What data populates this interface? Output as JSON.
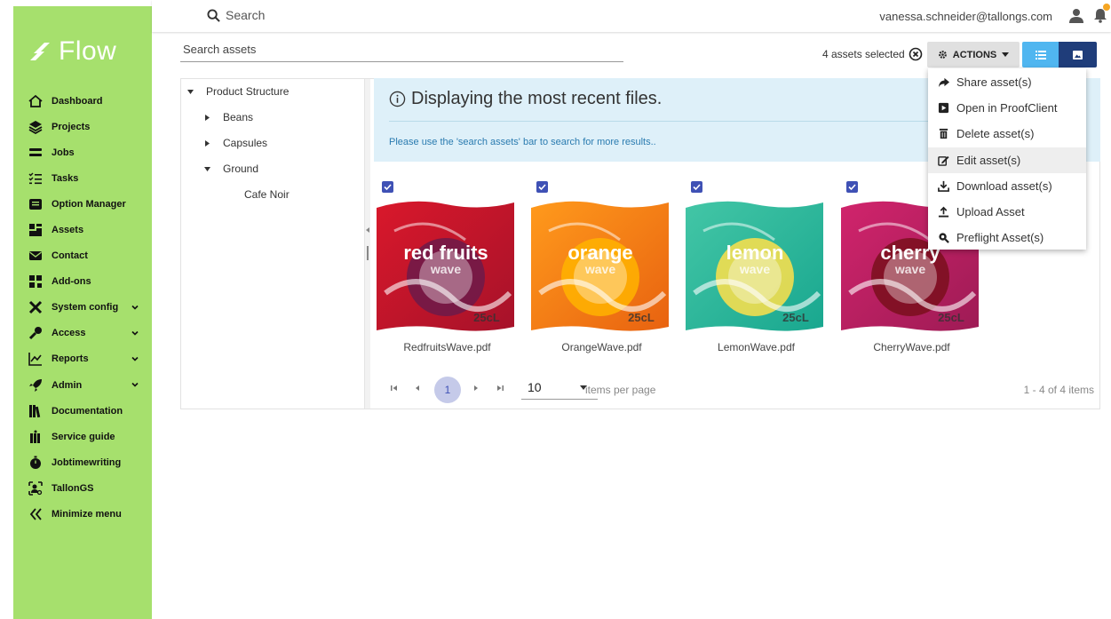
{
  "app": {
    "logo_text": "Flow"
  },
  "sidebar": {
    "items": [
      {
        "label": "Dashboard",
        "icon": "home-icon",
        "has_chevron": false
      },
      {
        "label": "Projects",
        "icon": "layers-icon",
        "has_chevron": false
      },
      {
        "label": "Jobs",
        "icon": "list-icon",
        "has_chevron": false
      },
      {
        "label": "Tasks",
        "icon": "tasks-icon",
        "has_chevron": false
      },
      {
        "label": "Option Manager",
        "icon": "option-icon",
        "has_chevron": false
      },
      {
        "label": "Assets",
        "icon": "assets-icon",
        "has_chevron": false
      },
      {
        "label": "Contact",
        "icon": "mail-icon",
        "has_chevron": false
      },
      {
        "label": "Add-ons",
        "icon": "addons-icon",
        "has_chevron": false
      },
      {
        "label": "System config",
        "icon": "tools-icon",
        "has_chevron": true
      },
      {
        "label": "Access",
        "icon": "key-icon",
        "has_chevron": true
      },
      {
        "label": "Reports",
        "icon": "chart-icon",
        "has_chevron": true
      },
      {
        "label": "Admin",
        "icon": "rocket-icon",
        "has_chevron": true
      },
      {
        "label": "Documentation",
        "icon": "books-icon",
        "has_chevron": false
      },
      {
        "label": "Service guide",
        "icon": "guide-icon",
        "has_chevron": false
      },
      {
        "label": "Jobtimewriting",
        "icon": "stopwatch-icon",
        "has_chevron": false
      },
      {
        "label": "TallonGS",
        "icon": "user-search-icon",
        "has_chevron": false
      },
      {
        "label": "Minimize menu",
        "icon": "double-chevron-left-icon",
        "has_chevron": false
      }
    ]
  },
  "topbar": {
    "search_label": "Search",
    "user_email": "vanessa.schneider@tallongs.com"
  },
  "toolbar": {
    "asset_search_placeholder": "Search assets",
    "selected_text": "4 assets selected",
    "actions_label": "ACTIONS"
  },
  "actions_menu": {
    "items": [
      {
        "label": "Share asset(s)",
        "icon": "share-icon"
      },
      {
        "label": "Open in ProofClient",
        "icon": "proofclient-icon"
      },
      {
        "label": "Delete asset(s)",
        "icon": "trash-icon"
      },
      {
        "label": "Edit asset(s)",
        "icon": "edit-icon"
      },
      {
        "label": "Download asset(s)",
        "icon": "download-icon"
      },
      {
        "label": "Upload Asset",
        "icon": "upload-icon"
      },
      {
        "label": "Preflight Asset(s)",
        "icon": "preflight-icon"
      }
    ],
    "hovered_index": 3
  },
  "tree": {
    "root": "Product Structure",
    "children": [
      "Beans",
      "Capsules",
      "Ground"
    ],
    "grandchild": "Cafe Noir"
  },
  "info": {
    "title": "Displaying the most recent files.",
    "text": "Please use the 'search assets' bar to search for more results.."
  },
  "assets": [
    {
      "name": "RedfruitsWave.pdf",
      "brand": "red fruits",
      "wave": "wave",
      "size": "25cL",
      "colors": [
        "#d9182b",
        "#a6122a"
      ],
      "fruit": "#6c1a4a",
      "checked": true
    },
    {
      "name": "OrangeWave.pdf",
      "brand": "orange",
      "wave": "wave",
      "size": "25cL",
      "colors": [
        "#ff9a1c",
        "#e86210"
      ],
      "fruit": "#ffb300",
      "checked": true
    },
    {
      "name": "LemonWave.pdf",
      "brand": "lemon",
      "wave": "wave",
      "size": "25cL",
      "colors": [
        "#43c6a6",
        "#19a78f"
      ],
      "fruit": "#ffe14a",
      "checked": true
    },
    {
      "name": "CherryWave.pdf",
      "brand": "cherry",
      "wave": "wave",
      "size": "25cL",
      "colors": [
        "#d1246c",
        "#9e1b55"
      ],
      "fruit": "#7a0f1c",
      "checked": true
    }
  ],
  "pager": {
    "current_page": "1",
    "page_size": "10",
    "items_label": "items per page",
    "info": "1 - 4 of 4 items"
  },
  "colors": {
    "sidebar_bg": "#a6e06d",
    "accent_blue": "#50b6f0",
    "accent_navy": "#1f3d7a",
    "checkbox": "#3f51b5"
  }
}
